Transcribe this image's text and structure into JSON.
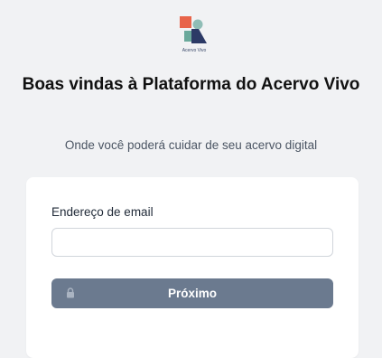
{
  "brand": {
    "logo_text": "Acervo Vivo",
    "colors": {
      "orange": "#e8644a",
      "teal": "#7fb5ad",
      "green": "#5fa89a",
      "navy": "#2c3a66"
    }
  },
  "header": {
    "title": "Boas vindas à Plataforma do Acervo Vivo",
    "subtitle": "Onde você poderá cuidar de seu acervo digital"
  },
  "form": {
    "email_label": "Endereço de email",
    "email_value": "",
    "email_placeholder": "",
    "next_label": "Próximo",
    "next_icon": "lock-icon",
    "button_color": "#6b7a8f"
  }
}
